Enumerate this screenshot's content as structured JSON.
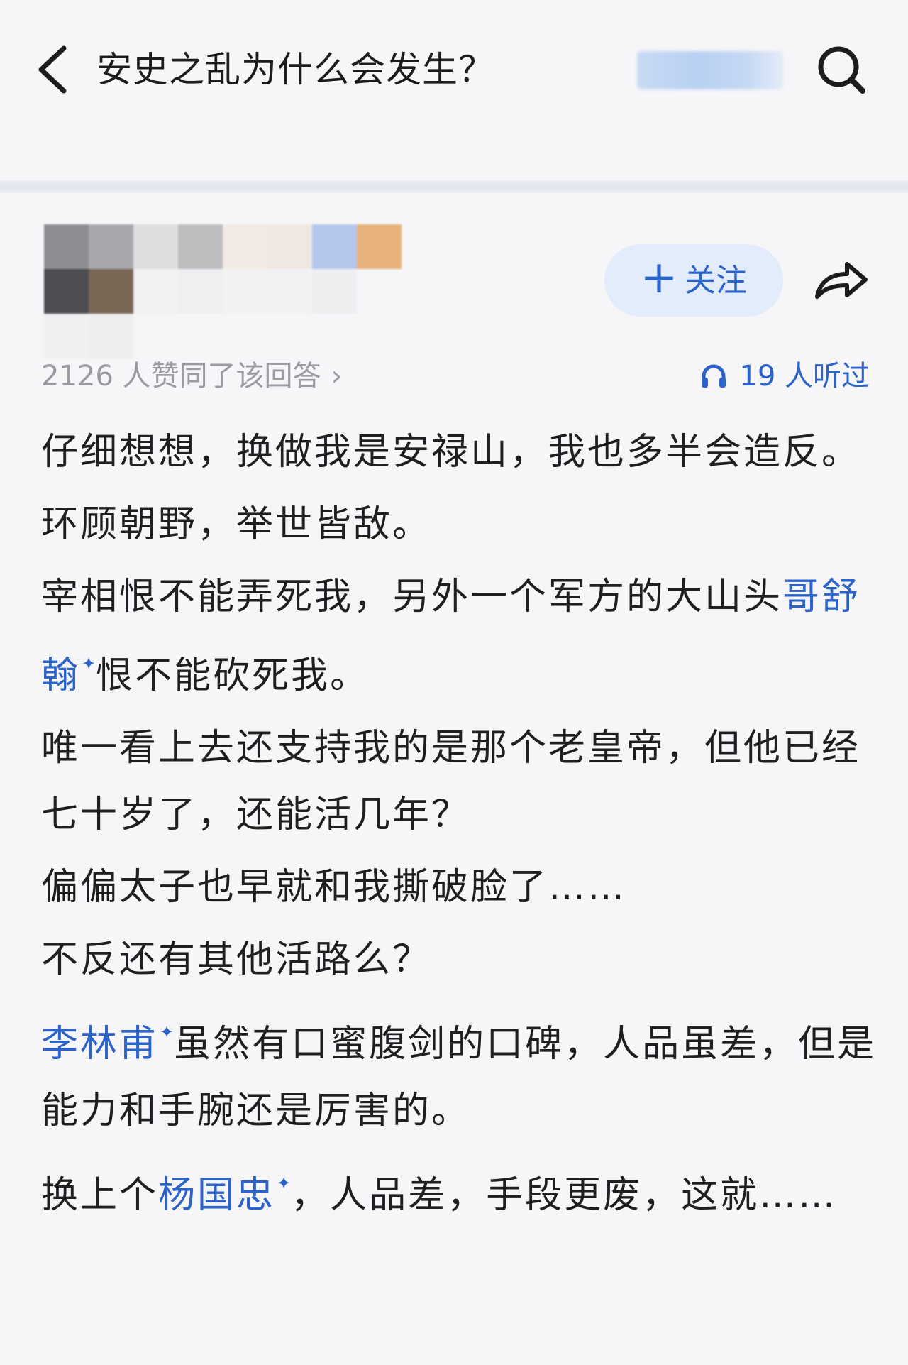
{
  "nav": {
    "title": "安史之乱为什么会发生？",
    "back_icon": "chevron-left-icon",
    "search_icon": "search-icon"
  },
  "author": {
    "follow_label": "关注",
    "follow_plus": "＋",
    "share_icon": "share-arrow-icon"
  },
  "meta": {
    "upvote_text": "2126 人赞同了该回答",
    "upvote_chevron": "›",
    "listen_text": "19 人听过",
    "listen_icon": "headphones-icon"
  },
  "body": {
    "p1": "仔细想想，换做我是安禄山，我也多半会造反。",
    "p2": "环顾朝野，举世皆敌。",
    "p3_a": "宰相恨不能弄死我，另外一个军方的大山头",
    "p3_link": "哥舒翰",
    "p3_b": "恨不能砍死我。",
    "p4": "唯一看上去还支持我的是那个老皇帝，但他已经七十岁了，还能活几年？",
    "p5": "偏偏太子也早就和我撕破脸了……",
    "p6": "不反还有其他活路么？",
    "p7_link": "李林甫",
    "p7_b": "虽然有口蜜腹剑的口碑，人品虽差，但是能力和手腕还是厉害的。",
    "p8_a": "换上个",
    "p8_link": "杨国忠",
    "p8_b": "，人品差，手段更废，这就……",
    "spark_glyph": "✦"
  },
  "colors": {
    "accent": "#2b63c9",
    "text": "#1f1f22",
    "muted": "#9b9ca3",
    "background": "#f6f6f8",
    "follow_bg": "#e3ecfa"
  }
}
